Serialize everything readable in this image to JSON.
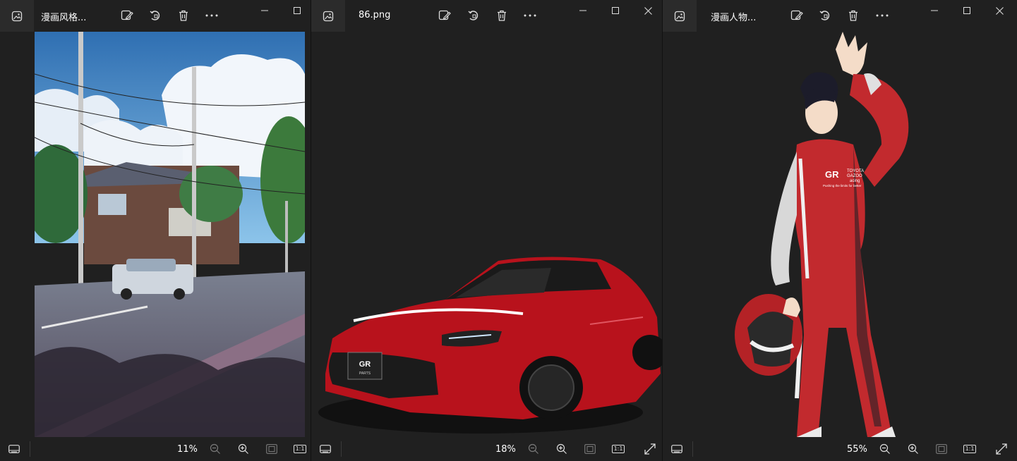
{
  "windows": [
    {
      "tab_title": "漫画风格...",
      "zoom": "11%",
      "one_to_one": "1:1",
      "photo": "anime-style street with utility poles, houses and a parked white car"
    },
    {
      "tab_title": "86.png",
      "zoom": "18%",
      "one_to_one": "1:1",
      "photo": "red Toyota GR86 sports car",
      "plate_text": {
        "brand": "GR",
        "sub": "PARTS"
      }
    },
    {
      "tab_title": "漫画人物...",
      "zoom": "55%",
      "one_to_one": "1:1",
      "photo": "anime racing driver in red suit holding helmet",
      "logo_text": {
        "gr": "GR",
        "line1": "TOYOTA",
        "line2": "GAZOO",
        "line3": "acing",
        "tagline": "Pushing the limits for better"
      }
    }
  ],
  "colors": {
    "background": "#202020",
    "icon": "#dcdcdc",
    "car_red": "#b8121c",
    "suit_red": "#c22a2e"
  },
  "icons": [
    "photos-app-icon",
    "edit-image-icon",
    "rotate-icon",
    "delete-icon",
    "more-icon",
    "minimize-icon",
    "maximize-icon",
    "close-icon",
    "filmstrip-icon",
    "zoom-out-icon",
    "zoom-in-icon",
    "fit-to-window-icon",
    "actual-size-icon",
    "fullscreen-icon"
  ]
}
